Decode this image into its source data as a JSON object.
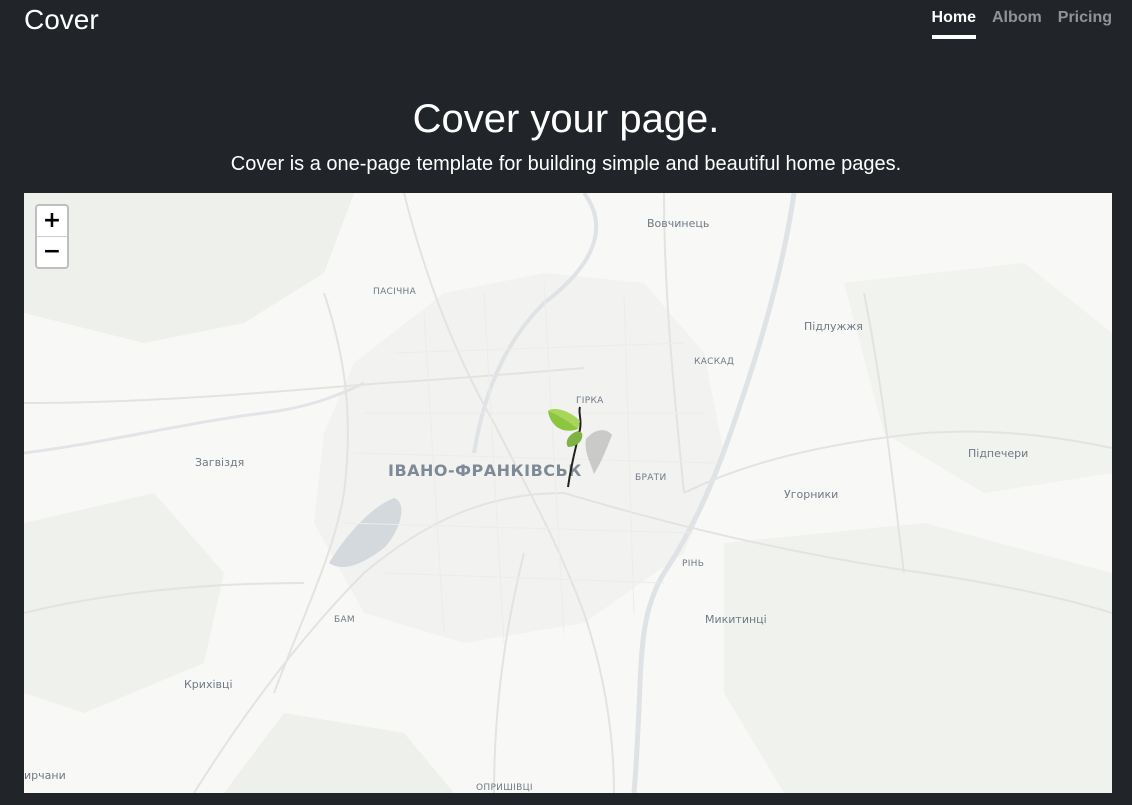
{
  "brand": "Cover",
  "nav": [
    {
      "label": "Home",
      "active": true
    },
    {
      "label": "Albom",
      "active": false
    },
    {
      "label": "Pricing",
      "active": false
    }
  ],
  "hero": {
    "title": "Cover your page.",
    "lead": "Cover is a one-page template for building simple and beautiful home pages."
  },
  "map": {
    "zoom_in": "+",
    "zoom_out": "−",
    "marker_icon": "leaf-marker-icon",
    "labels": {
      "vovchynets": "Вовчинець",
      "pasichna": "ПАСІЧНА",
      "pidluzhzhia": "Підлужжя",
      "kaskad": "КАСКАД",
      "hirka": "ГІРКА",
      "zahvizdia": "Загвіздя",
      "city": "ІВАНО-ФРАНКІВСЬК",
      "braty": "БРАТИ",
      "pidpechery": "Підпечери",
      "uhornyky": "Угорники",
      "rin": "РІНЬ",
      "bam": "БАМ",
      "mykytyntsi": "Микитинці",
      "kryhivtsi": "Крихівці",
      "myrchany": "ирчани",
      "opryshivtsi": "ОПРИШІВЦІ"
    }
  }
}
